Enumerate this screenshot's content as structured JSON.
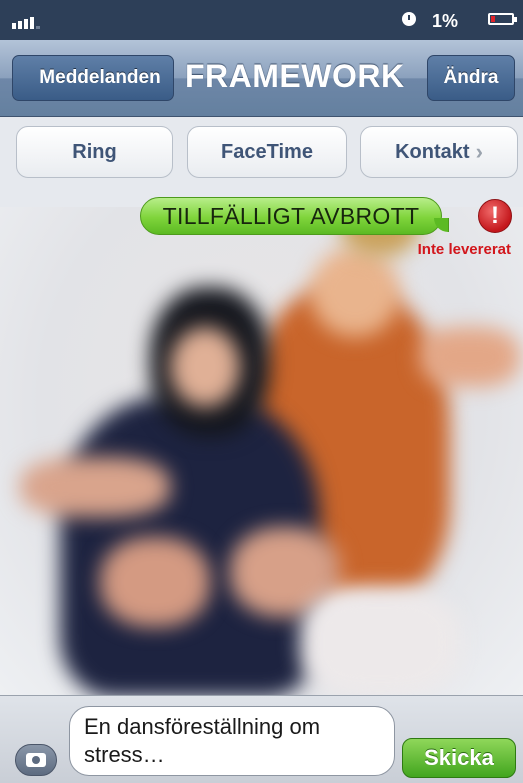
{
  "status_bar": {
    "battery_percent": "1%",
    "icons": [
      "signal-icon",
      "clock-icon",
      "battery-icon"
    ],
    "battery_level": 0.05,
    "colors": {
      "background": "#2d3f58",
      "battery_low": "#e0242a"
    }
  },
  "navbar": {
    "back_label": "Meddelanden",
    "title": "FRAMEWORK",
    "edit_label": "Ändra"
  },
  "actions": {
    "call_label": "Ring",
    "facetime_label": "FaceTime",
    "contact_label": "Kontakt",
    "contact_chevron": "›"
  },
  "message": {
    "text": "TILLFÄLLIGT AVBROTT",
    "error_icon": "!",
    "status": "Inte levererat",
    "colors": {
      "bubble": "#7fd43b",
      "error": "#d2161c"
    }
  },
  "composer": {
    "text_line1": "En dansföreställning om",
    "text_line2": "stress…",
    "send_label": "Skicka",
    "camera_icon": "camera-icon"
  }
}
